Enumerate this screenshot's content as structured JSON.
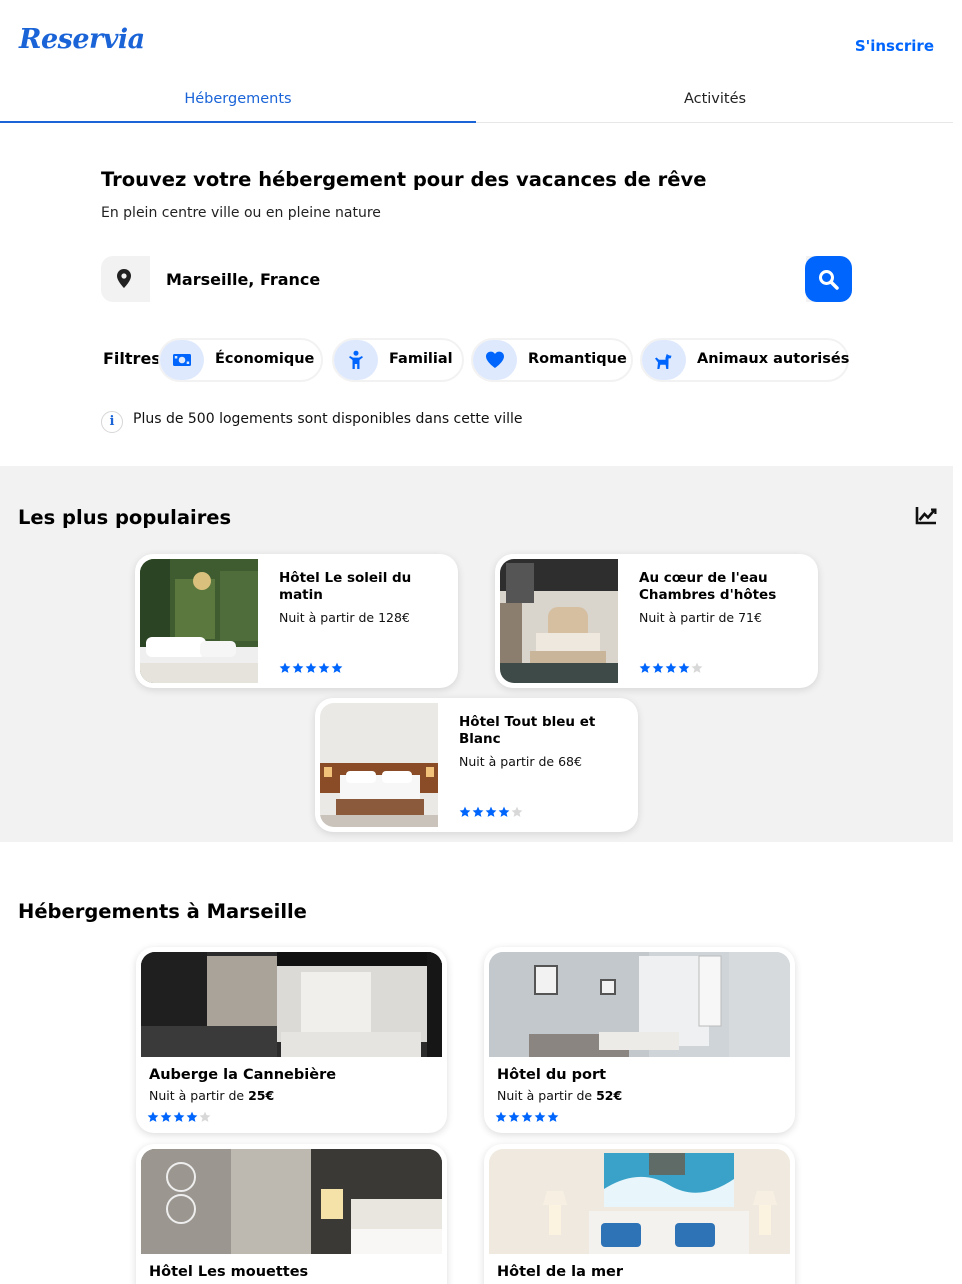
{
  "header": {
    "logo": "Reservia",
    "signup_label": "S'inscrire"
  },
  "tabs": [
    {
      "label": "Hébergements",
      "active": true
    },
    {
      "label": "Activités",
      "active": false
    }
  ],
  "hero": {
    "title": "Trouvez votre hébergement pour des vacances de rêve",
    "subtitle": "En plein centre ville ou en pleine nature"
  },
  "search": {
    "value": "Marseille, France",
    "location_icon": "map-pin-icon",
    "button_icon": "search-icon"
  },
  "filters": {
    "label": "Filtres",
    "items": [
      {
        "label": "Économique",
        "icon": "money-icon"
      },
      {
        "label": "Familial",
        "icon": "child-icon"
      },
      {
        "label": "Romantique",
        "icon": "heart-icon"
      },
      {
        "label": "Animaux autorisés",
        "icon": "dog-icon"
      }
    ]
  },
  "info": {
    "text": "Plus de 500 logements sont disponibles dans cette ville",
    "icon": "info-icon"
  },
  "popular": {
    "title": "Les plus populaires",
    "icon": "trend-chart-icon",
    "items": [
      {
        "name": "Hôtel Le soleil du matin",
        "price": "Nuit à partir de 128€",
        "rating": 5
      },
      {
        "name": "Au cœur de l'eau Chambres d'hôtes",
        "price": "Nuit à partir de 71€",
        "rating": 4
      },
      {
        "name": "Hôtel Tout bleu et Blanc",
        "price": "Nuit à partir de 68€",
        "rating": 4
      }
    ]
  },
  "lodgings": {
    "title": "Hébergements à Marseille",
    "price_prefix": "Nuit à partir de",
    "items": [
      {
        "name": "Auberge la Cannebière",
        "price": "25€",
        "rating": 4
      },
      {
        "name": "Hôtel du port",
        "price": "52€",
        "rating": 5
      },
      {
        "name": "Hôtel Les mouettes",
        "price": "",
        "rating": 0
      },
      {
        "name": "Hôtel de la mer",
        "price": "",
        "rating": 0
      }
    ]
  },
  "colors": {
    "accent": "#0065fc",
    "accent_light": "#dee9fd",
    "section_bg": "#f2f2f2",
    "star_off": "#d8d8d8"
  }
}
